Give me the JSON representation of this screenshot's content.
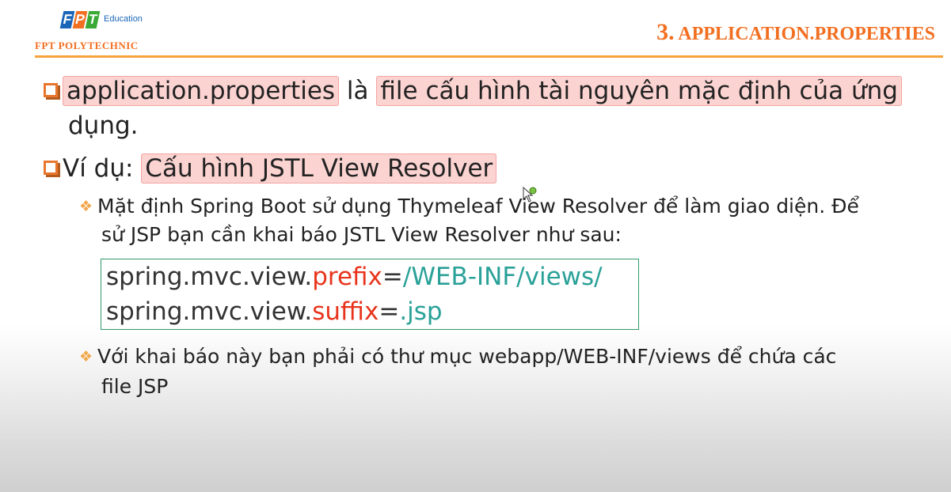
{
  "header": {
    "logo_letters": [
      "F",
      "P",
      "T"
    ],
    "logo_sub": "Education",
    "org_name": "FPT POLYTECHNIC",
    "title_number": "3.",
    "title_text": "APPLICATION.PROPERTIES"
  },
  "bullets": [
    {
      "parts": {
        "hl1": "application.properties",
        "text1": " là ",
        "hl2": "file cấu hình tài nguyên mặc định của ứng",
        "cont": "dụng."
      }
    },
    {
      "parts": {
        "text1": "Ví dụ: ",
        "hl1": "Cấu hình JSTL View Resolver"
      }
    }
  ],
  "sub_bullets": [
    {
      "line1": "Mặt định Spring Boot sử dụng Thymeleaf View Resolver để làm giao diện. Để",
      "line2": "sử JSP bạn cần khai báo JSTL View Resolver như sau:"
    },
    {
      "line1": "Với khai báo này bạn phải có thư mục webapp/WEB-INF/views để chứa các",
      "line2": "file JSP"
    }
  ],
  "code": [
    {
      "key_prefix": "spring.mvc.view.",
      "key": "prefix",
      "eq": "=",
      "value": "/WEB-INF/views/"
    },
    {
      "key_prefix": "spring.mvc.view.",
      "key": "suffix",
      "eq": "=",
      "value": ".jsp"
    }
  ],
  "colors": {
    "accent_orange": "#f26f21",
    "highlight_bg": "#fbd3d1",
    "code_key": "#e8341c",
    "code_value": "#2aa198",
    "code_border": "#2f9a6a"
  }
}
